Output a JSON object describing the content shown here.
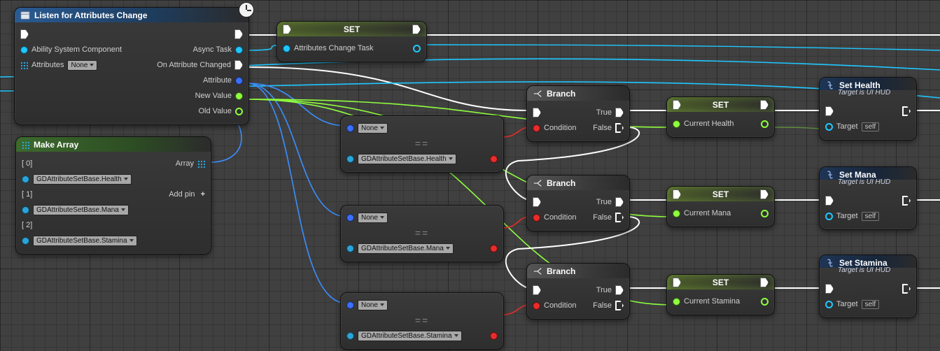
{
  "listen": {
    "title": "Listen for Attributes Change",
    "inputs": {
      "ability_sys": "Ability System Component",
      "attributes": "Attributes",
      "attributes_value": "None"
    },
    "outputs": {
      "async_task": "Async Task",
      "on_changed": "On Attribute Changed",
      "attribute": "Attribute",
      "new_value": "New Value",
      "old_value": "Old Value"
    }
  },
  "set_task": {
    "title": "SET",
    "var": "Attributes Change Task"
  },
  "make_array": {
    "title": "Make Array",
    "out": "Array",
    "addpin": "Add pin",
    "items": [
      {
        "idx": "[ 0]",
        "val": "GDAttributeSetBase.Health"
      },
      {
        "idx": "[ 1]",
        "val": "GDAttributeSetBase.Mana"
      },
      {
        "idx": "[ 2]",
        "val": "GDAttributeSetBase.Stamina"
      }
    ]
  },
  "eq_nodes": [
    {
      "none": "None",
      "attr": "GDAttributeSetBase.Health"
    },
    {
      "none": "None",
      "attr": "GDAttributeSetBase.Mana"
    },
    {
      "none": "None",
      "attr": "GDAttributeSetBase.Stamina"
    }
  ],
  "branch": {
    "title": "Branch",
    "condition": "Condition",
    "true": "True",
    "false": "False"
  },
  "setvars": [
    {
      "title": "SET",
      "var": "Current Health"
    },
    {
      "title": "SET",
      "var": "Current Mana"
    },
    {
      "title": "SET",
      "var": "Current Stamina"
    }
  ],
  "fncalls": [
    {
      "title": "Set Health",
      "subtitle": "Target is UI HUD"
    },
    {
      "title": "Set Mana",
      "subtitle": "Target is UI HUD"
    },
    {
      "title": "Set Stamina",
      "subtitle": "Target is UI HUD"
    }
  ],
  "target": "Target",
  "self": "self"
}
